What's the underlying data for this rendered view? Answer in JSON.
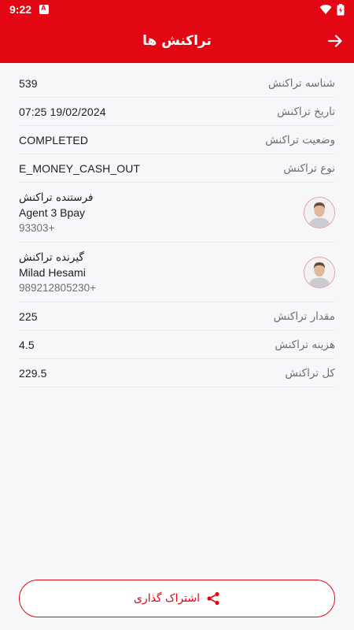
{
  "status_bar": {
    "time": "9:22"
  },
  "header": {
    "title": "تراکنش ها"
  },
  "details": [
    {
      "label": "شناسه تراکنش",
      "value": "539"
    },
    {
      "label": "تاریخ تراکنش",
      "value": "07:25 19/02/2024"
    },
    {
      "label": "وضعیت تراکنش",
      "value": "COMPLETED"
    },
    {
      "label": "نوع تراکنش",
      "value": "E_MONEY_CASH_OUT"
    }
  ],
  "sender": {
    "title": "فرستنده تراکنش",
    "name": "Agent 3 Bpay",
    "phone": "93303+"
  },
  "receiver": {
    "title": "گیرنده تراکنش",
    "name": "Milad Hesami",
    "phone": "989212805230+"
  },
  "amounts": [
    {
      "label": "مقدار تراکنش",
      "value": "225"
    },
    {
      "label": "هزینه تراکنش",
      "value": "4.5"
    },
    {
      "label": "کل تراکنش",
      "value": "229.5"
    }
  ],
  "share_button": {
    "label": "اشتراک گذاری"
  },
  "colors": {
    "accent": "#e30613",
    "label": "#6d6d76",
    "text": "#1d1d24"
  }
}
